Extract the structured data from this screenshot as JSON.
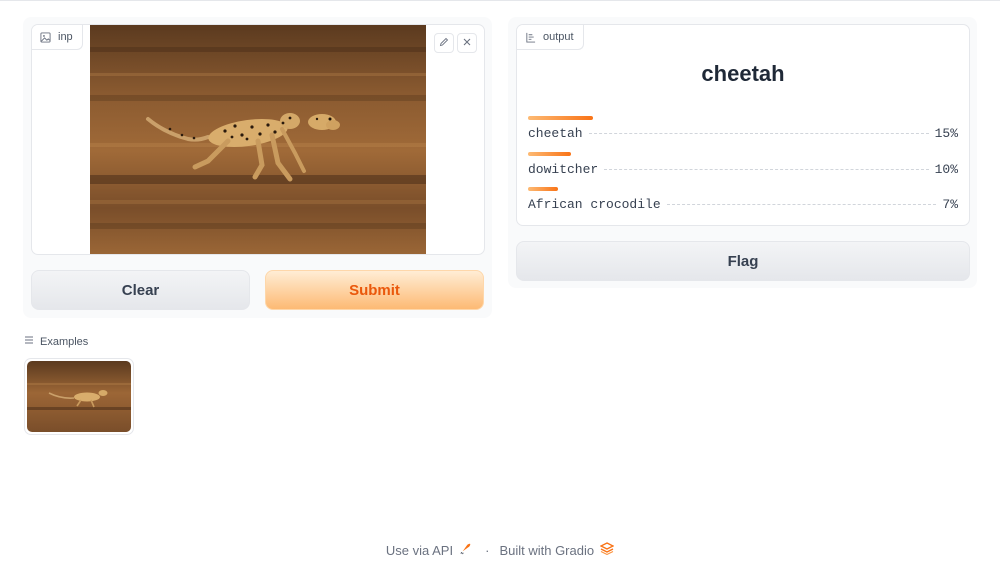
{
  "input": {
    "label": "inp",
    "image_alt": "cheetah running"
  },
  "buttons": {
    "clear": "Clear",
    "submit": "Submit",
    "flag": "Flag"
  },
  "output": {
    "label": "output",
    "top_label": "cheetah",
    "confidences": [
      {
        "label": "cheetah",
        "value": "15%",
        "fraction": 0.15
      },
      {
        "label": "dowitcher",
        "value": "10%",
        "fraction": 0.1
      },
      {
        "label": "African crocodile",
        "value": "7%",
        "fraction": 0.07
      }
    ]
  },
  "examples": {
    "label": "Examples"
  },
  "footer": {
    "api_link": "Use via API",
    "separator": "·",
    "built_with": "Built with Gradio"
  },
  "colors": {
    "accent": "#f97316",
    "submit_text": "#ea580c"
  },
  "icons": [
    "image-icon",
    "edit-icon",
    "close-icon",
    "label-icon",
    "list-icon",
    "rocket-icon",
    "gradio-logo-icon"
  ]
}
